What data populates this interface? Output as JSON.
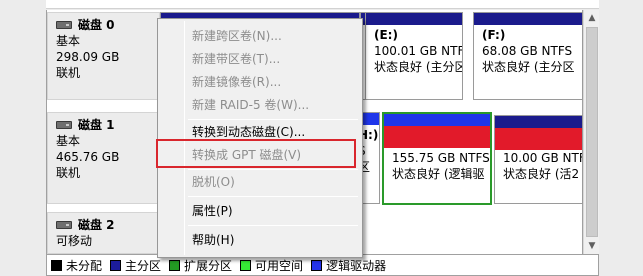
{
  "disks": [
    {
      "title": "磁盘 0",
      "type": "基本",
      "size": "298.09 GB",
      "status": "联机"
    },
    {
      "title": "磁盘 1",
      "type": "基本",
      "size": "465.76 GB",
      "status": "联机"
    },
    {
      "title": "磁盘 2",
      "type": "可移动",
      "size": "",
      "status": ""
    }
  ],
  "partitions": {
    "disk0_e": {
      "letter": "(E:)",
      "size": "100.01 GB NTFS",
      "status": "状态良好 (主分区"
    },
    "disk0_f": {
      "letter": "(F:)",
      "size": "68.08 GB NTFS",
      "status": "状态良好 (主分区"
    },
    "disk1_h": {
      "letter": "H:)",
      "size": "S",
      "status": "区"
    },
    "disk1_mid": {
      "size": "155.75 GB NTFS",
      "status": "状态良好 (逻辑驱"
    },
    "disk1_right": {
      "size": "10.00 GB NTFS",
      "status": "状态良好 (活2"
    }
  },
  "context_menu": {
    "items": [
      {
        "label": "新建跨区卷(N)...",
        "enabled": false
      },
      {
        "label": "新建带区卷(T)...",
        "enabled": false
      },
      {
        "label": "新建镜像卷(R)...",
        "enabled": false
      },
      {
        "label": "新建 RAID-5 卷(W)...",
        "enabled": false
      },
      {
        "label": "转换到动态磁盘(C)...",
        "enabled": true
      },
      {
        "label": "转换成 GPT 磁盘(V)",
        "enabled": false
      },
      {
        "label": "脱机(O)",
        "enabled": false
      },
      {
        "label": "属性(P)",
        "enabled": true
      },
      {
        "label": "帮助(H)",
        "enabled": true
      }
    ]
  },
  "legend": [
    {
      "label": "未分配",
      "color": "#000000"
    },
    {
      "label": "主分区",
      "color": "#1c1c9c"
    },
    {
      "label": "扩展分区",
      "color": "#239b23"
    },
    {
      "label": "可用空间",
      "color": "#36e836"
    },
    {
      "label": "逻辑驱动器",
      "color": "#2534eb"
    }
  ],
  "colors": {
    "primary_bar": "#1b1b8c",
    "logical_bar": "#1f36ea",
    "extended_border": "#2a9a2a",
    "active_red": "#e21a2a",
    "highlight": "#d9262d"
  }
}
